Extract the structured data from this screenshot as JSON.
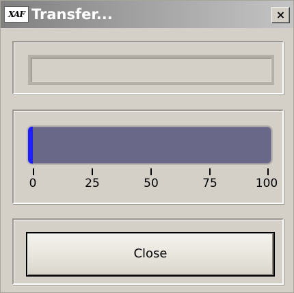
{
  "window": {
    "title": "Transfer...",
    "app_icon_text": "XAF",
    "close_glyph": "×"
  },
  "status_field": {
    "value": ""
  },
  "progress": {
    "percent": 2,
    "fill_color": "#1e1eff",
    "track_color": "#6a6888",
    "scale_labels": [
      "0",
      "25",
      "50",
      "75",
      "100"
    ]
  },
  "actions": {
    "close_label": "Close"
  },
  "colors": {
    "face": "#d4d0c8",
    "title_gradient_start": "#808080",
    "title_gradient_end": "#c4c4c4"
  }
}
